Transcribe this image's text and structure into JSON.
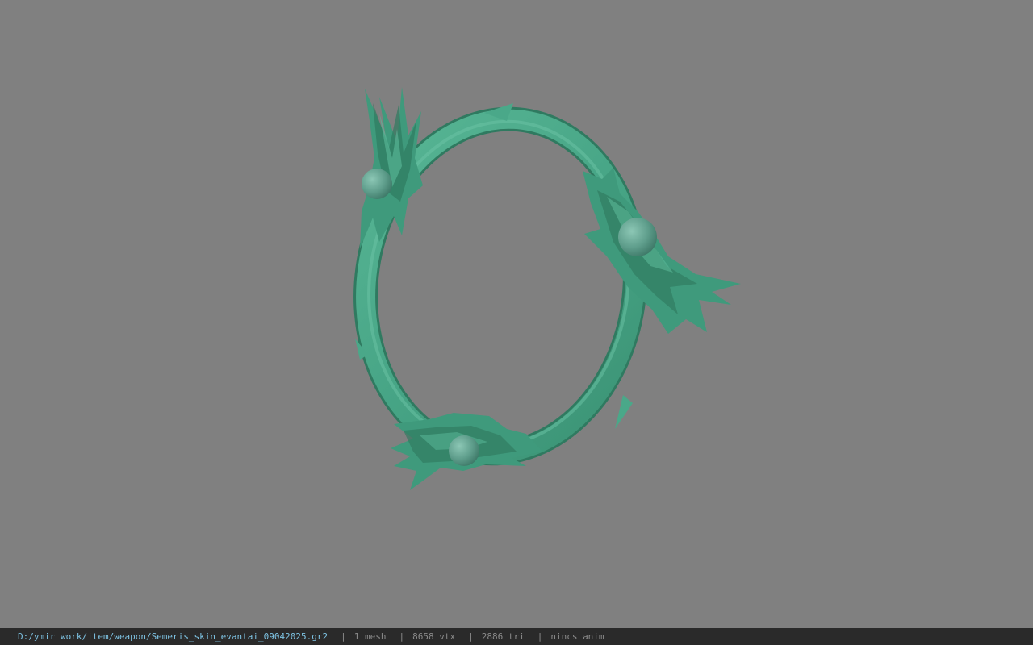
{
  "viewport": {
    "background_color": "#808080",
    "model": {
      "name": "ring-weapon-model",
      "base_color": "#4aa889",
      "dark_color": "#2f7a60",
      "light_color": "#6cc4a5",
      "orb_color": "#5f9e8c"
    }
  },
  "status_bar": {
    "file_path": "D:/ymir work/item/weapon/Semeris_skin_evantai_09042025.gr2",
    "separator": "|",
    "mesh_count": "1 mesh",
    "vertex_count": "8658 vtx",
    "triangle_count": "2886 tri",
    "animation": "nincs anim",
    "path_color": "#7ec3e3",
    "text_color": "#8a8a8a",
    "background_color": "#2a2a2a"
  }
}
